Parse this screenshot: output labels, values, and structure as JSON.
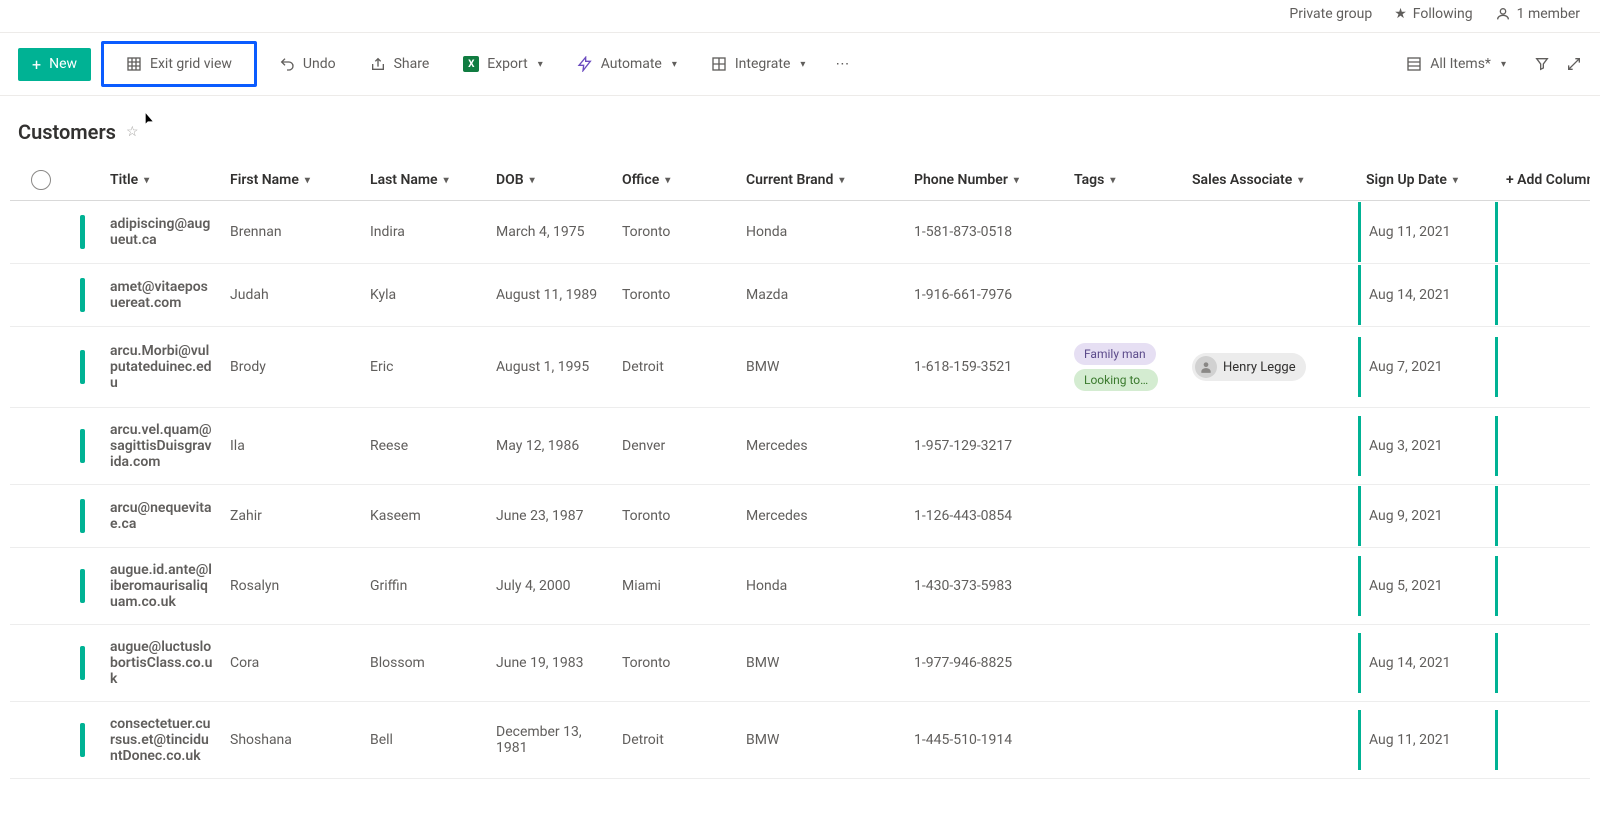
{
  "info_bar": {
    "group": "Private group",
    "following": "Following",
    "members": "1 member"
  },
  "cmd": {
    "new": "New",
    "exit_grid": "Exit grid view",
    "undo": "Undo",
    "share": "Share",
    "export": "Export",
    "automate": "Automate",
    "integrate": "Integrate",
    "view": "All Items*"
  },
  "list": {
    "title": "Customers"
  },
  "columns": {
    "title": "Title",
    "first_name": "First Name",
    "last_name": "Last Name",
    "dob": "DOB",
    "office": "Office",
    "brand": "Current Brand",
    "phone": "Phone Number",
    "tags": "Tags",
    "sales": "Sales Associate",
    "signup": "Sign Up Date",
    "add": "+ Add Column"
  },
  "tags": {
    "family": "Family man",
    "looking": "Looking to…"
  },
  "sales_person": "Henry Legge",
  "rows": [
    {
      "title": "adipiscing@augueut.ca",
      "first": "Brennan",
      "last": "Indira",
      "dob": "March 4, 1975",
      "office": "Toronto",
      "brand": "Honda",
      "phone": "1-581-873-0518",
      "signup": "Aug 11, 2021"
    },
    {
      "title": "amet@vitaeposuereat.com",
      "first": "Judah",
      "last": "Kyla",
      "dob": "August 11, 1989",
      "office": "Toronto",
      "brand": "Mazda",
      "phone": "1-916-661-7976",
      "signup": "Aug 14, 2021"
    },
    {
      "title": "arcu.Morbi@vulputateduinec.edu",
      "first": "Brody",
      "last": "Eric",
      "dob": "August 1, 1995",
      "office": "Detroit",
      "brand": "BMW",
      "phone": "1-618-159-3521",
      "signup": "Aug 7, 2021",
      "has_tags": true,
      "has_person": true
    },
    {
      "title": "arcu.vel.quam@sagittisDuisgravida.com",
      "first": "Ila",
      "last": "Reese",
      "dob": "May 12, 1986",
      "office": "Denver",
      "brand": "Mercedes",
      "phone": "1-957-129-3217",
      "signup": "Aug 3, 2021"
    },
    {
      "title": "arcu@nequevitae.ca",
      "first": "Zahir",
      "last": "Kaseem",
      "dob": "June 23, 1987",
      "office": "Toronto",
      "brand": "Mercedes",
      "phone": "1-126-443-0854",
      "signup": "Aug 9, 2021"
    },
    {
      "title": "augue.id.ante@liberomaurisaliquam.co.uk",
      "first": "Rosalyn",
      "last": "Griffin",
      "dob": "July 4, 2000",
      "office": "Miami",
      "brand": "Honda",
      "phone": "1-430-373-5983",
      "signup": "Aug 5, 2021"
    },
    {
      "title": "augue@luctuslobortisClass.co.uk",
      "first": "Cora",
      "last": "Blossom",
      "dob": "June 19, 1983",
      "office": "Toronto",
      "brand": "BMW",
      "phone": "1-977-946-8825",
      "signup": "Aug 14, 2021"
    },
    {
      "title": "consectetuer.cursus.et@tinciduntDonec.co.uk",
      "first": "Shoshana",
      "last": "Bell",
      "dob": "December 13, 1981",
      "office": "Detroit",
      "brand": "BMW",
      "phone": "1-445-510-1914",
      "signup": "Aug 11, 2021"
    }
  ]
}
